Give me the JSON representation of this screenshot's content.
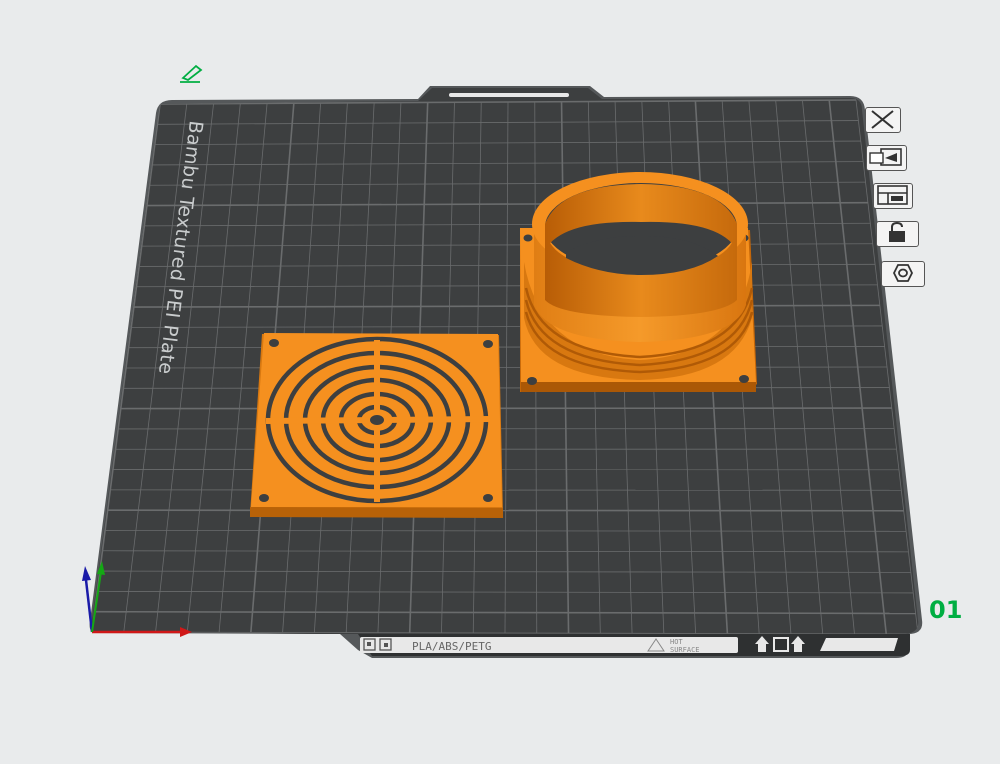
{
  "plate": {
    "name": "Bambu Textured PEI Plate",
    "number": "01",
    "strip_text": "PLA/ABS/PETG",
    "hot_surface_line1": "HOT",
    "hot_surface_line2": "SURFACE"
  },
  "toolbar": {
    "items": [
      {
        "icon": "close-icon"
      },
      {
        "icon": "auto-arrange-icon"
      },
      {
        "icon": "layout-icon"
      },
      {
        "icon": "lock-icon"
      },
      {
        "icon": "settings-hex-icon"
      }
    ]
  },
  "edit_icon": "pencil-icon",
  "colors": {
    "plate": "#3d3f40",
    "grid": "#6a6c6d",
    "model": "#f5901f",
    "accent": "#00ae42"
  }
}
